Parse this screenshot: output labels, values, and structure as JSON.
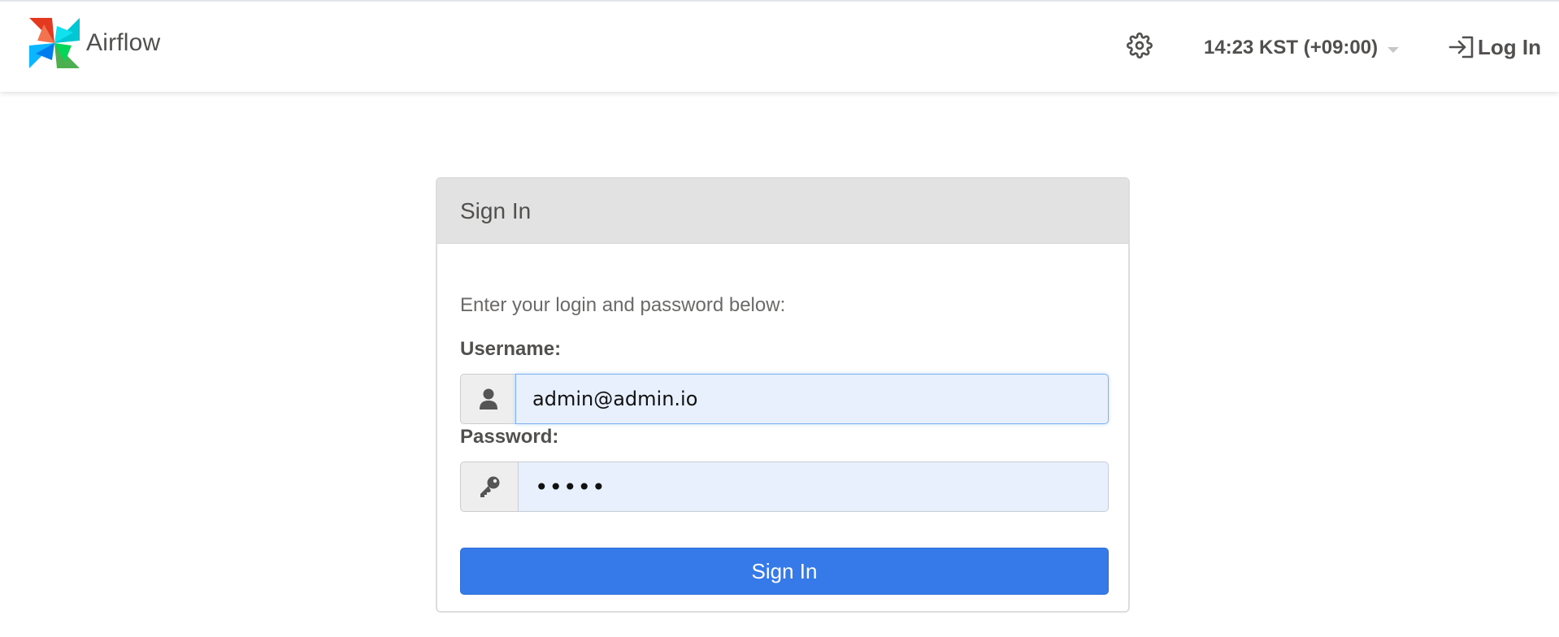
{
  "app": {
    "brand_name": "Airflow"
  },
  "navbar": {
    "settings_icon": "gear-icon",
    "clock_text": "14:23 KST (+09:00)",
    "login_label": "Log In",
    "login_icon": "sign-in-icon"
  },
  "login_panel": {
    "title": "Sign In",
    "intro": "Enter your login and password below:",
    "username": {
      "label": "Username:",
      "value": "admin@admin.io",
      "icon": "user-icon"
    },
    "password": {
      "label": "Password:",
      "value": "•••••",
      "icon": "key-icon"
    },
    "submit_label": "Sign In"
  },
  "colors": {
    "primary_button": "#357ae8",
    "autofill_background": "#e8f0fe",
    "panel_heading": "#e2e2e2",
    "text": "#51504f"
  }
}
